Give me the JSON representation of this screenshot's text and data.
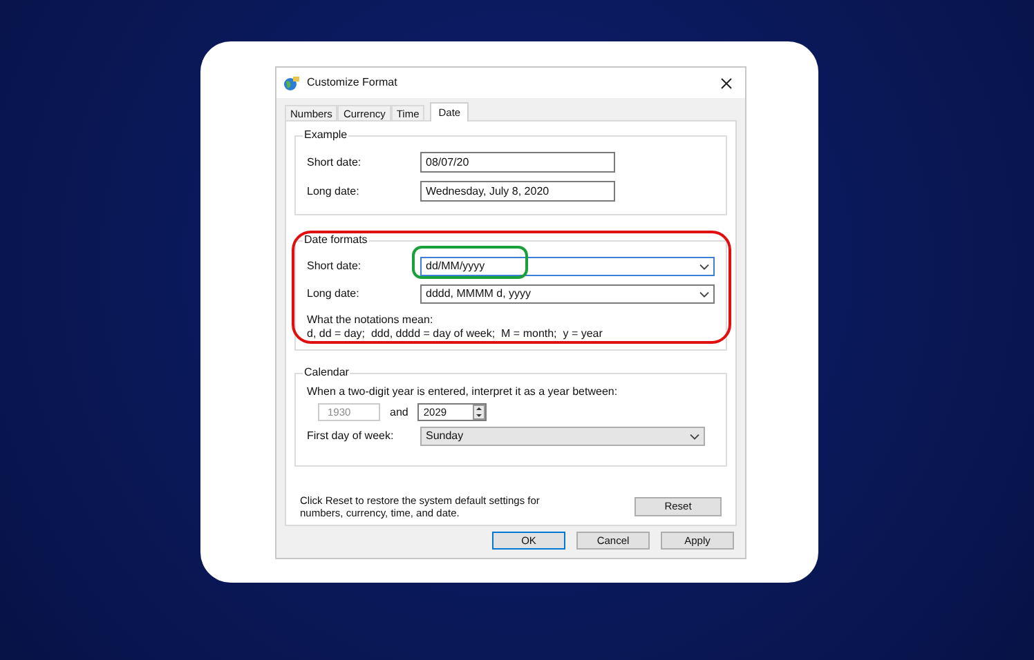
{
  "window": {
    "title": "Customize Format"
  },
  "tabs": [
    {
      "label": "Numbers",
      "selected": false
    },
    {
      "label": "Currency",
      "selected": false
    },
    {
      "label": "Time",
      "selected": false
    },
    {
      "label": "Date",
      "selected": true
    }
  ],
  "example": {
    "title": "Example",
    "fields": [
      {
        "label": "Short date:",
        "value": "08/07/20"
      },
      {
        "label": "Long date:",
        "value": "Wednesday, July 8, 2020"
      }
    ]
  },
  "date_formats": {
    "title": "Date formats",
    "fields": [
      {
        "label": "Short date:",
        "value": "dd/MM/yyyy"
      },
      {
        "label": "Long date:",
        "value": "dddd, MMMM d, yyyy"
      }
    ],
    "notes": [
      "What the notations mean:",
      "d, dd = day;  ddd, dddd = day of week;  M = month;  y = year"
    ]
  },
  "calendar": {
    "title": "Calendar",
    "prompt": "When a two-digit year is entered, interpret it as a year between:",
    "year_from": {
      "value": "1930",
      "disabled": true
    },
    "between": "and",
    "year_to": "2029",
    "first_day_label": "First day of week:",
    "first_day": "Sunday"
  },
  "reset_note": "Click Reset to restore the system default settings for numbers, currency, time, and date.",
  "reset_button": "Reset",
  "buttons": [
    {
      "label": "OK",
      "default": true
    },
    {
      "label": "Cancel",
      "default": false
    },
    {
      "label": "Apply",
      "default": false
    }
  ]
}
